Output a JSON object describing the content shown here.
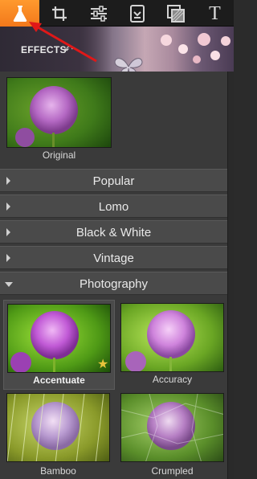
{
  "toolbar": {
    "items": [
      {
        "name": "effects",
        "icon": "flask-icon",
        "active": true
      },
      {
        "name": "crop",
        "icon": "crop-icon",
        "active": false
      },
      {
        "name": "adjust",
        "icon": "sliders-icon",
        "active": false
      },
      {
        "name": "frame",
        "icon": "frame-icon",
        "active": false
      },
      {
        "name": "texture",
        "icon": "layers-icon",
        "active": false
      },
      {
        "name": "text",
        "icon": "text-icon",
        "glyph": "T",
        "active": false
      }
    ],
    "accent": "#f2781b"
  },
  "banner": {
    "label": "EFFECTS",
    "undo_glyph": "↶"
  },
  "original": {
    "label": "Original"
  },
  "categories": [
    {
      "label": "Popular",
      "expanded": false
    },
    {
      "label": "Lomo",
      "expanded": false
    },
    {
      "label": "Black & White",
      "expanded": false
    },
    {
      "label": "Vintage",
      "expanded": false
    },
    {
      "label": "Photography",
      "expanded": true
    }
  ],
  "photography_effects": [
    {
      "label": "Accentuate",
      "selected": true,
      "starred": true
    },
    {
      "label": "Accuracy",
      "selected": false
    },
    {
      "label": "Bamboo",
      "selected": false
    },
    {
      "label": "Crumpled",
      "selected": false
    }
  ],
  "star_glyph": "★"
}
